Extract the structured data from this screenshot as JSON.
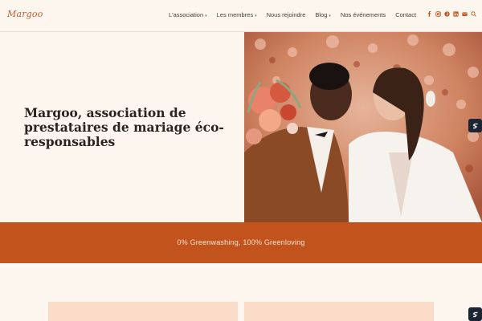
{
  "brand": {
    "logo": "Margoo",
    "accent": "#c2531d"
  },
  "nav": {
    "items": [
      {
        "label": "L'association",
        "dropdown": true
      },
      {
        "label": "Les membres",
        "dropdown": true
      },
      {
        "label": "Nous rejoindre",
        "dropdown": false
      },
      {
        "label": "Blog",
        "dropdown": true
      },
      {
        "label": "Nos événements",
        "dropdown": false
      },
      {
        "label": "Contact",
        "dropdown": false
      }
    ]
  },
  "socials": [
    "facebook-icon",
    "instagram-icon",
    "pinterest-icon",
    "linkedin-icon",
    "email-icon",
    "search-icon"
  ],
  "hero": {
    "title": "Margoo, association de prestataires de mariage éco-responsables"
  },
  "band": {
    "text": "0% Greenwashing, 100% Greenloving"
  }
}
